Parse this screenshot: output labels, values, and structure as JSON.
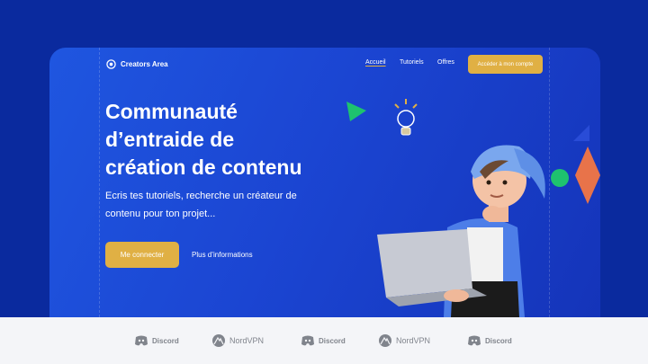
{
  "nav": {
    "brand": "Creators Area",
    "items": [
      {
        "label": "Accueil",
        "active": true
      },
      {
        "label": "Tutoriels",
        "active": false
      },
      {
        "label": "Offres",
        "active": false
      }
    ],
    "cta": "Accéder à mon compte"
  },
  "hero": {
    "title_line1": "Communauté",
    "title_line2": "d’entraide de",
    "title_line3": "création de contenu",
    "subtitle_line1": "Ecris tes tutoriels, recherche un créateur de",
    "subtitle_line2": "contenu pour ton projet...",
    "primary_button": "Me connecter",
    "secondary_link": "Plus d’informations"
  },
  "partners": [
    {
      "name": "Discord",
      "icon": "discord-icon"
    },
    {
      "name": "NordVPN",
      "icon": "nordvpn-icon"
    },
    {
      "name": "Discord",
      "icon": "discord-icon"
    },
    {
      "name": "NordVPN",
      "icon": "nordvpn-icon"
    },
    {
      "name": "Discord",
      "icon": "discord-icon"
    }
  ],
  "colors": {
    "background": "#0a2a9e",
    "hero_gradient_start": "#1f56e0",
    "hero_gradient_end": "#1433b8",
    "accent": "#e0b044",
    "partner_bar": "#f4f5f8",
    "shape_green": "#1ec26f",
    "shape_orange": "#e8734a"
  }
}
